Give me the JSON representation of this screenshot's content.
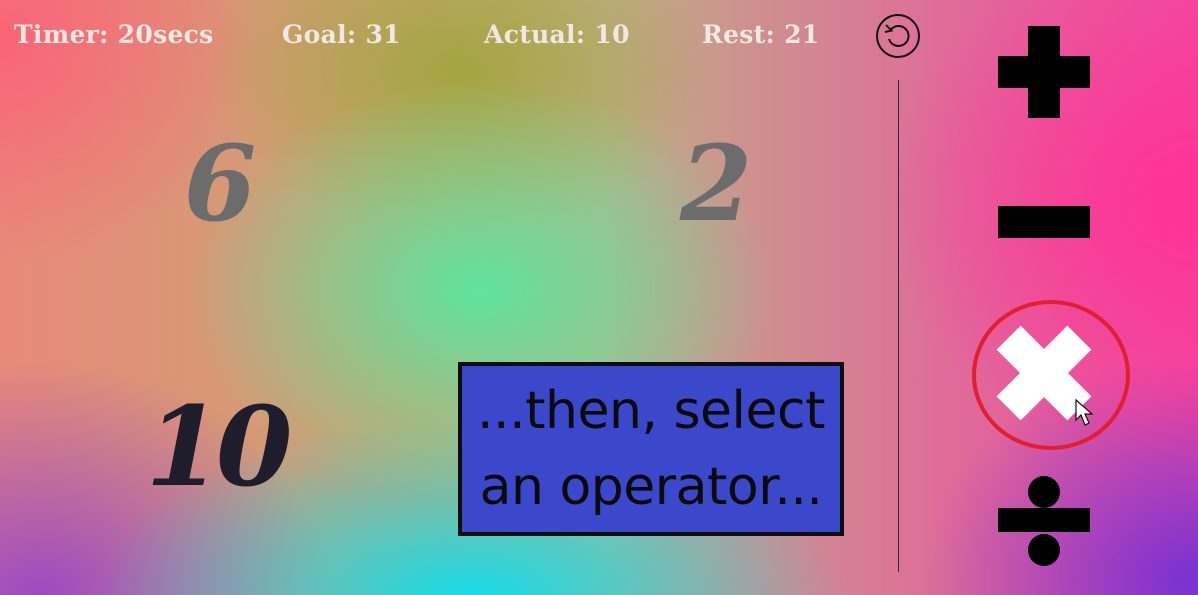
{
  "stats": {
    "timer": {
      "label": "Timer:",
      "value": "20secs"
    },
    "goal": {
      "label": "Goal:",
      "value": "31"
    },
    "actual": {
      "label": "Actual:",
      "value": "10"
    },
    "rest": {
      "label": "Rest:",
      "value": "21"
    }
  },
  "numbers": {
    "top_left": "6",
    "top_right": "2",
    "bottom_left": "10"
  },
  "hint": {
    "line1": "...then, select",
    "line2": "an operator..."
  },
  "operators": [
    "plus",
    "minus",
    "times",
    "divide"
  ],
  "selected_operator": "times",
  "colors": {
    "stat_text": "#f1e8e4",
    "number_inactive": "#6c6c6c",
    "number_selected": "#1f1d2b",
    "hint_box": "#3b48cc",
    "highlight_ring": "#e02030"
  },
  "icons": {
    "reset": "reset-icon",
    "cursor": "mouse-pointer-icon"
  }
}
